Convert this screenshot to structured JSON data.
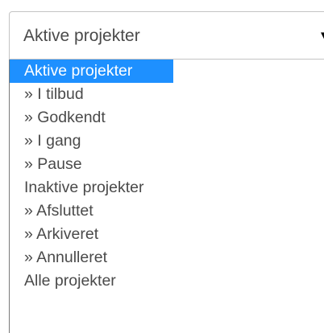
{
  "select": {
    "current_value": "Aktive projekter",
    "arrow_icon": "triangle-down-icon"
  },
  "options": [
    {
      "label": "Aktive projekter",
      "selected": true,
      "child": false
    },
    {
      "label": "» I tilbud",
      "selected": false,
      "child": true
    },
    {
      "label": "» Godkendt",
      "selected": false,
      "child": true
    },
    {
      "label": "» I gang",
      "selected": false,
      "child": true
    },
    {
      "label": "» Pause",
      "selected": false,
      "child": true
    },
    {
      "label": "Inaktive projekter",
      "selected": false,
      "child": false
    },
    {
      "label": "» Afsluttet",
      "selected": false,
      "child": true
    },
    {
      "label": "» Arkiveret",
      "selected": false,
      "child": true
    },
    {
      "label": "» Annulleret",
      "selected": false,
      "child": true
    },
    {
      "label": "Alle projekter",
      "selected": false,
      "child": false
    }
  ],
  "colors": {
    "highlight": "#1e90ff",
    "text": "#4a4a4a"
  }
}
